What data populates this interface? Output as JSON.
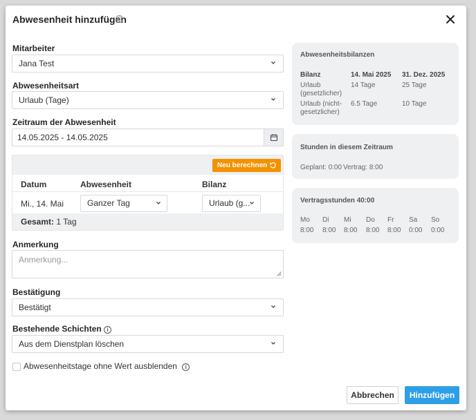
{
  "dialog": {
    "title": "Abwesenheit hinzufügen",
    "help_glyph": "?"
  },
  "form": {
    "employee": {
      "label": "Mitarbeiter",
      "value": "Jana Test"
    },
    "absence_type": {
      "label": "Abwesenheitsart",
      "value": "Urlaub (Tage)"
    },
    "period": {
      "label": "Zeitraum der Abwesenheit",
      "value": "14.05.2025 - 14.05.2025"
    },
    "table": {
      "recalc_label": "Neu berechnen",
      "headers": [
        "Datum",
        "Abwesenheit",
        "Bilanz"
      ],
      "rows": [
        {
          "date": "Mi., 14. Mai",
          "absence": "Ganzer Tag",
          "balance": "Urlaub (g..."
        }
      ],
      "total_label": "Gesamt:",
      "total_value": "1 Tag"
    },
    "note": {
      "label": "Anmerkung",
      "placeholder": "Anmerkung..."
    },
    "confirmation": {
      "label": "Bestätigung",
      "value": "Bestätigt"
    },
    "existing_shifts": {
      "label": "Bestehende Schichten",
      "value": "Aus dem Dienstplan löschen"
    },
    "hide_zero_days": {
      "label": "Abwesenheitstage ohne Wert ausblenden",
      "checked": false
    },
    "info_glyph": "i"
  },
  "buttons": {
    "cancel": "Abbrechen",
    "add": "Hinzufügen"
  },
  "balances_card": {
    "title": "Abwesenheitsbilanzen",
    "header": [
      "Bilanz",
      "14. Mai 2025",
      "31. Dez. 2025"
    ],
    "rows": [
      {
        "name_line1": "Urlaub",
        "name_line2": "(gesetzlicher)",
        "v1": "14 Tage",
        "v2": "25 Tage"
      },
      {
        "name_line1": "Urlaub (nicht-",
        "name_line2": "gesetzlicher)",
        "v1": "6.5 Tage",
        "v2": "10 Tage"
      }
    ]
  },
  "hours_card": {
    "title": "Stunden in diesem Zeitraum",
    "planned": "Geplant: 0:00",
    "contract": "Vertrag: 8:00"
  },
  "contract_card": {
    "title": "Vertragsstunden 40:00",
    "days": [
      {
        "day": "Mo",
        "hours": "8:00"
      },
      {
        "day": "Di",
        "hours": "8:00"
      },
      {
        "day": "Mi",
        "hours": "8:00"
      },
      {
        "day": "Do",
        "hours": "8:00"
      },
      {
        "day": "Fr",
        "hours": "8:00"
      },
      {
        "day": "Sa",
        "hours": "0:00"
      },
      {
        "day": "So",
        "hours": "0:00"
      }
    ]
  },
  "colors": {
    "primary": "#2e9fe6",
    "recalc": "#f39200",
    "card_bg": "#eef0f2"
  }
}
